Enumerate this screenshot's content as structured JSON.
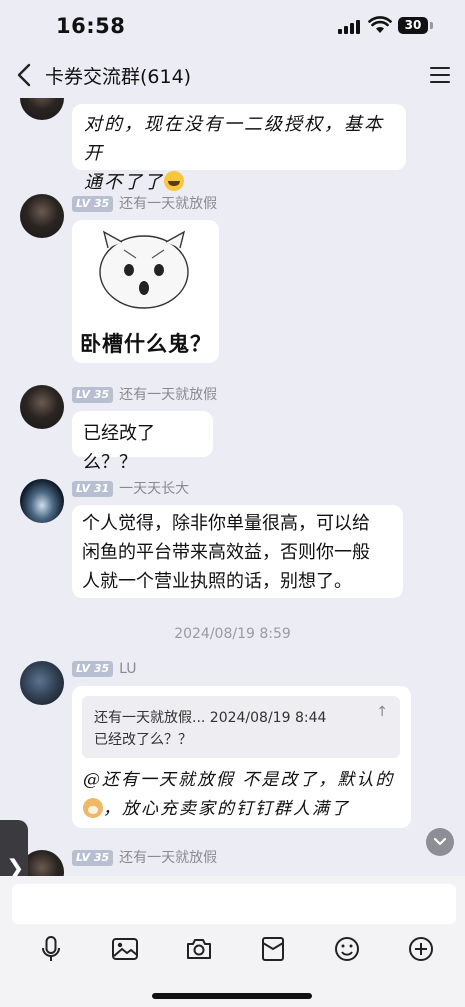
{
  "status": {
    "time": "16:58",
    "battery": "30"
  },
  "header": {
    "title": "卡券交流群(614)"
  },
  "messages": [
    {
      "text_l1": "对的，现在没有一二级授权，基本开",
      "text_l2": "通不了了",
      "emoji": "laughing-face"
    },
    {
      "lv": "LV 35",
      "nick": "还有一天就放假",
      "sticker_caption": "卧槽什么鬼？"
    },
    {
      "lv": "LV 35",
      "nick": "还有一天就放假",
      "text": "已经改了么？？"
    },
    {
      "lv": "LV 31",
      "nick": "一天天长大",
      "text_l1": "个人觉得，除非你单量很高，可以给",
      "text_l2": "闲鱼的平台带来高效益，否则你一般",
      "text_l3": "人就一个营业执照的话，别想了。"
    },
    {
      "timestamp": "2024/08/19 8:59"
    },
    {
      "lv": "LV 35",
      "nick": "LU",
      "quote": {
        "head": "还有一天就放假... 2024/08/19 8:44",
        "body": "已经改了么？？",
        "pin": "↑"
      },
      "text_l1": "@还有一天就放假 不是改了，默认的",
      "text_l2": "，放心充卖家的钉钉群人满了",
      "emoji": "dog-face"
    },
    {
      "lv": "LV 35",
      "nick": "还有一天就放假"
    }
  ],
  "side_tab": {
    "label": "❯"
  },
  "input": {
    "placeholder": ""
  },
  "toolbar": [
    "voice-icon",
    "image-icon",
    "camera-icon",
    "red-packet-icon",
    "emoji-icon",
    "plus-icon"
  ]
}
